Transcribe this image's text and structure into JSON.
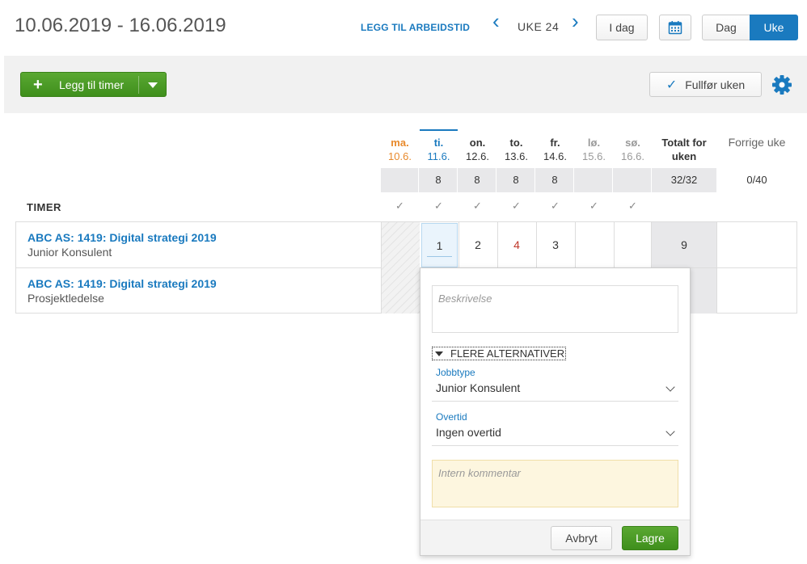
{
  "header": {
    "date_range": "10.06.2019 - 16.06.2019",
    "add_worktime": "LEGG TIL ARBEIDSTID",
    "prev_icon": "‹",
    "next_icon": "›",
    "week_label": "UKE 24",
    "today": "I dag",
    "day_view": "Dag",
    "week_view": "Uke",
    "accent": "#1a7abf"
  },
  "toolbar": {
    "add_hours": "Legg til timer",
    "complete_week": "Fullfør uken"
  },
  "days": [
    {
      "name": "ma.",
      "date": "10.6.",
      "sum": ""
    },
    {
      "name": "ti.",
      "date": "11.6.",
      "sum": "8"
    },
    {
      "name": "on.",
      "date": "12.6.",
      "sum": "8"
    },
    {
      "name": "to.",
      "date": "13.6.",
      "sum": "8"
    },
    {
      "name": "fr.",
      "date": "14.6.",
      "sum": "8"
    },
    {
      "name": "lø.",
      "date": "15.6.",
      "sum": ""
    },
    {
      "name": "sø.",
      "date": "16.6.",
      "sum": ""
    }
  ],
  "totals": {
    "header": "Totalt for uken",
    "sum": "32/32",
    "prev_header": "Forrige uke",
    "prev_sum": "0/40"
  },
  "section_label": "TIMER",
  "rows": [
    {
      "project": "ABC AS: 1419: Digital strategi 2019",
      "role": "Junior Konsulent",
      "hours": [
        "",
        "1",
        "2",
        "4",
        "3",
        "",
        ""
      ],
      "total": "9"
    },
    {
      "project": "ABC AS: 1419: Digital strategi 2019",
      "role": "Prosjektledelse"
    }
  ],
  "editor": {
    "description_placeholder": "Beskrivelse",
    "more_options": "FLERE ALTERNATIVER",
    "jobtype_label": "Jobbtype",
    "jobtype_value": "Junior Konsulent",
    "overtime_label": "Overtid",
    "overtime_value": "Ingen overtid",
    "comment_placeholder": "Intern kommentar",
    "cancel": "Avbryt",
    "save": "Lagre"
  }
}
